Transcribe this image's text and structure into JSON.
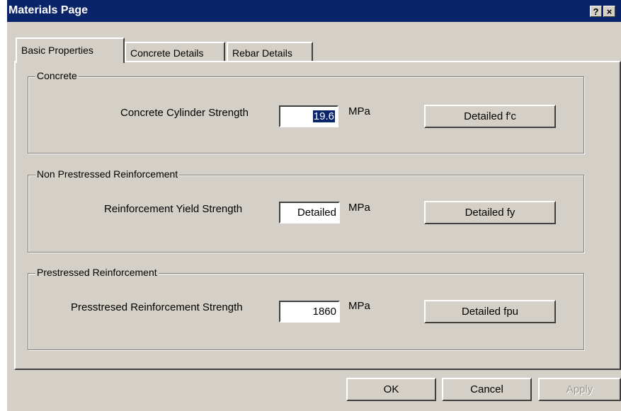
{
  "window": {
    "title": "Materials Page",
    "help_label": "?",
    "close_label": "×"
  },
  "tabs": [
    {
      "label": "Basic Properties"
    },
    {
      "label": "Concrete Details"
    },
    {
      "label": "Rebar Details"
    }
  ],
  "groups": {
    "concrete": {
      "title": "Concrete",
      "field_label": "Concrete Cylinder Strength",
      "value": "19.6",
      "unit": "MPa",
      "button": "Detailed f'c"
    },
    "non_prestressed": {
      "title": "Non Prestressed Reinforcement",
      "field_label": "Reinforcement Yield Strength",
      "value": "Detailed",
      "unit": "MPa",
      "button": "Detailed fy"
    },
    "prestressed": {
      "title": "Prestressed Reinforcement",
      "field_label": "Presstresed Reinforcement Strength",
      "value": "1860",
      "unit": "MPa",
      "button": "Detailed fpu"
    }
  },
  "footer": {
    "ok": "OK",
    "cancel": "Cancel",
    "apply": "Apply"
  },
  "colors": {
    "titlebar": "#0a246a",
    "face": "#d4d0c8"
  }
}
